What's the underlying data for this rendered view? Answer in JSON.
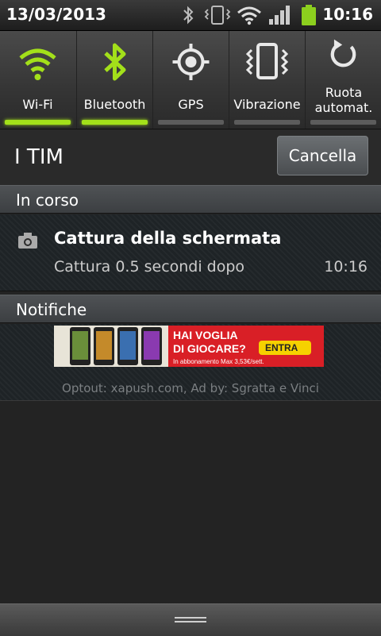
{
  "status_bar": {
    "date": "13/03/2013",
    "time": "10:16",
    "icons": [
      "bluetooth-icon",
      "vibrate-icon",
      "wifi-icon",
      "signal-icon",
      "battery-icon"
    ],
    "battery_color": "#8ccf1e"
  },
  "toggles": [
    {
      "label": "Wi-Fi",
      "icon": "wifi-icon",
      "active": true
    },
    {
      "label": "Bluetooth",
      "icon": "bluetooth-icon",
      "active": true
    },
    {
      "label": "GPS",
      "icon": "gps-icon",
      "active": false
    },
    {
      "label": "Vibrazione",
      "icon": "vibrate-icon",
      "active": false
    },
    {
      "label": "Ruota automat.",
      "label_line1": "Ruota",
      "label_line2": "automat.",
      "icon": "rotate-icon",
      "active": false
    }
  ],
  "carrier": "I TIM",
  "cancel_label": "Cancella",
  "sections": {
    "ongoing": "In corso",
    "notifications": "Notifiche"
  },
  "ongoing_notification": {
    "icon": "camera-icon",
    "title": "Cattura della schermata",
    "subtitle": "Cattura 0.5 secondi dopo",
    "time": "10:16"
  },
  "ad": {
    "banner_text_line1": "HAI VOGLIA",
    "banner_text_line2": "DI GIOCARE?",
    "banner_button": "ENTRA",
    "banner_small": "In abbonamento Max  3,53€/sett.",
    "credit": "Optout: xapush.com, Ad by: Sgratta e Vinci"
  },
  "colors": {
    "accent_green": "#a3e01a",
    "banner_red": "#d91f26",
    "banner_yellow": "#f6d100"
  }
}
